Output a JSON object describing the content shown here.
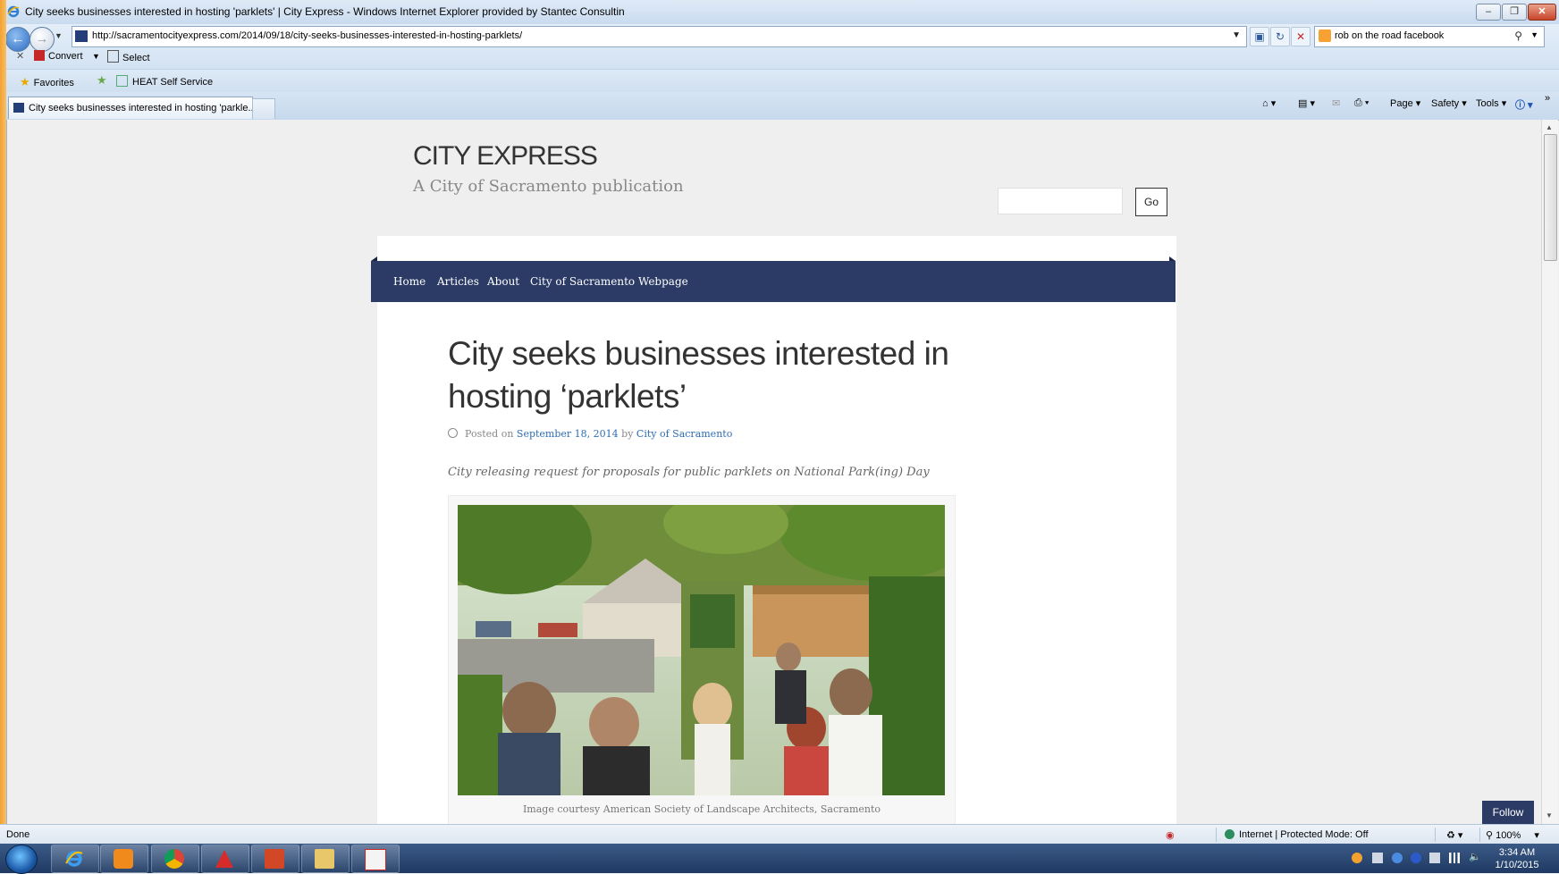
{
  "window": {
    "title": "City seeks businesses interested in hosting 'parklets' | City Express - Windows Internet Explorer provided by Stantec Consultin",
    "address": "http://sacramentocityexpress.com/2014/09/18/city-seeks-businesses-interested-in-hosting-parklets/",
    "search_value": "rob on the road facebook",
    "tab_label": "City seeks businesses interested in hosting 'parkle...",
    "convert_label": "Convert",
    "select_label": "Select",
    "favorites_label": "Favorites",
    "fav_item": "HEAT Self Service",
    "cmd": {
      "page": "Page",
      "safety": "Safety",
      "tools": "Tools"
    }
  },
  "site": {
    "title": "CITY EXPRESS",
    "subtitle": "A City of Sacramento publication",
    "search_placeholder": "",
    "go_label": "Go",
    "menu": [
      "Home",
      "Articles",
      "About",
      "City of Sacramento Webpage"
    ]
  },
  "article": {
    "headline": "City seeks businesses interested in hosting ‘parklets’",
    "posted_on": "Posted on",
    "date": "September 18, 2014",
    "by": "by",
    "author": "City of Sacramento",
    "lede": "City releasing request for proposals for public parklets on National Park(ing) Day",
    "caption": "Image courtesy American Society of Landscape Architects, Sacramento"
  },
  "follow_label": "Follow",
  "status": {
    "left": "Done",
    "zone": "Internet | Protected Mode: Off",
    "zoom": "100%"
  },
  "taskbar": {
    "time": "3:34 AM",
    "date": "1/10/2015"
  },
  "colors": {
    "menu_bg": "#2c3b66",
    "link": "#2e6db4"
  }
}
